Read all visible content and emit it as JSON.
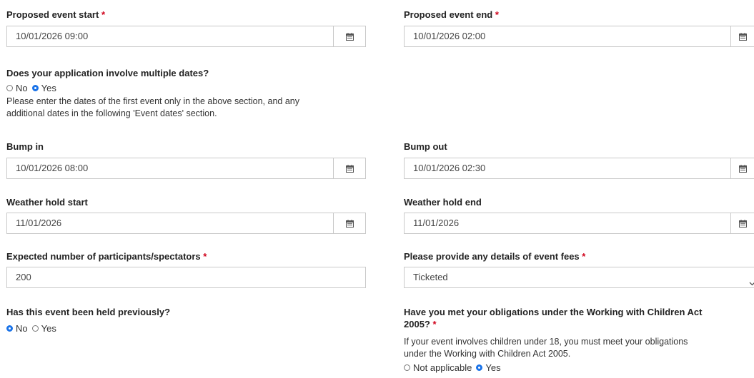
{
  "proposed_start": {
    "label": "Proposed event start",
    "required_mark": "*",
    "value": "10/01/2026 09:00"
  },
  "proposed_end": {
    "label": "Proposed event end",
    "required_mark": "*",
    "value": "10/01/2026 02:00"
  },
  "multiple_dates": {
    "question": "Does your application involve multiple dates?",
    "options": [
      "No",
      "Yes"
    ],
    "selected": "Yes",
    "help_line1": "Please enter the dates of the first event only in the above section, and any",
    "help_line2": "additional dates in the following 'Event dates' section."
  },
  "bump_in": {
    "label": "Bump in",
    "value": "10/01/2026 08:00"
  },
  "bump_out": {
    "label": "Bump out",
    "value": "10/01/2026 02:30"
  },
  "weather_start": {
    "label": "Weather hold start",
    "value": "11/01/2026"
  },
  "weather_end": {
    "label": "Weather hold end",
    "value": "11/01/2026"
  },
  "participants": {
    "label": "Expected number of participants/spectators",
    "required_mark": "*",
    "value": "200"
  },
  "event_fees": {
    "label": "Please provide any details of event fees",
    "required_mark": "*",
    "value": "Ticketed"
  },
  "held_previously": {
    "question": "Has this event been held previously?",
    "options": [
      "No",
      "Yes"
    ],
    "selected": "No"
  },
  "wwc": {
    "question_line1": "Have you met your obligations under the Working with Children Act",
    "question_line2": "2005?",
    "required_mark": "*",
    "help_line1": "If your event involves children under 18, you must meet your obligations",
    "help_line2": "under the Working with Children Act 2005.",
    "options": [
      "Not applicable",
      "Yes"
    ],
    "selected": "Yes"
  },
  "icons": {
    "date_picker": "calendar-icon",
    "dropdown": "chevron-down-icon"
  },
  "colors": {
    "required": "#d0021b",
    "radio_checked": "#1a73e8",
    "border": "#c9c9c9"
  }
}
